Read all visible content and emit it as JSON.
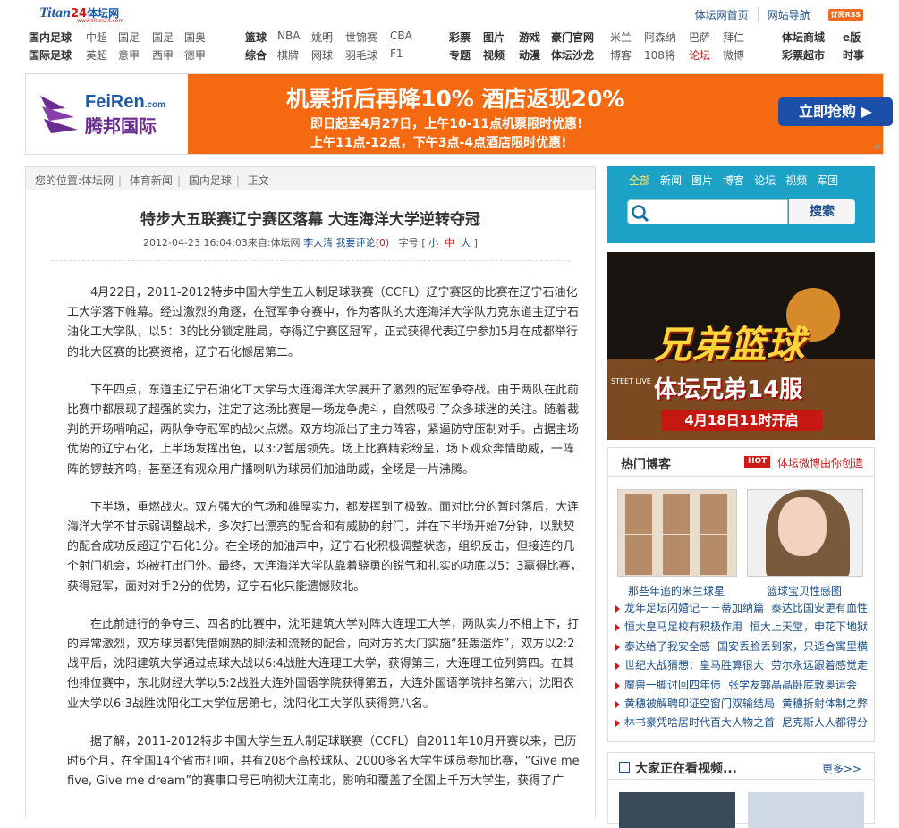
{
  "header": {
    "logo": {
      "titan": "Titan",
      "num": "24",
      "cn": "体坛网",
      "sub": "www.titan24.com"
    },
    "links": [
      "体坛网首页",
      "网站导航"
    ],
    "rss": "订阅RSS"
  },
  "nav": {
    "row1": [
      "国内足球",
      "中超",
      "国足",
      "国足",
      "国奥",
      "篮球",
      "NBA",
      "姚明",
      "世锦赛",
      "CBA",
      "彩票",
      "图片",
      "游戏",
      "豪门官网",
      "米兰",
      "阿森纳",
      "巴萨",
      "拜仁",
      "体坛商城",
      "e版"
    ],
    "row2": [
      "国际足球",
      "英超",
      "意甲",
      "西甲",
      "德甲",
      "综合",
      "棋牌",
      "网球",
      "羽毛球",
      "F1",
      "专题",
      "视频",
      "动漫",
      "体坛沙龙",
      "博客",
      "108将",
      "论坛",
      "微博",
      "彩票超市",
      "时事"
    ]
  },
  "banner": {
    "brand_en": "FeiRen",
    "brand_dom": ".com",
    "brand_cn": "腾邦国际",
    "headline": "机票折后再降10% 酒店返现20%",
    "line1": "即日起至4月27日，上午10-11点机票限时优惠!",
    "line2": "上午11点-12点，下午3点-4点酒店限时优惠!",
    "cta": "立即抢购"
  },
  "breadcrumb": [
    "您的位置:体坛网",
    "体育新闻",
    "国内足球",
    "正文"
  ],
  "article": {
    "title": "特步大五联赛辽宁赛区落幕 大连海洋大学逆转夺冠",
    "date": "2012-04-23 16:04:03",
    "source_label": "来自:",
    "source": "体坛网",
    "author": "李大清",
    "comment": "我要评论",
    "comment_count": "(0)",
    "font_label": "字号:",
    "font_small": "小",
    "font_mid": "中",
    "font_large": "大",
    "paragraphs": [
      "4月22日，2011-2012特步中国大学生五人制足球联赛（CCFL）辽宁赛区的比赛在辽宁石油化工大学落下帷幕。经过激烈的角逐，在冠军争夺赛中，作为客队的大连海洋大学队力克东道主辽宁石油化工大学队，以5：3的比分锁定胜局，夺得辽宁赛区冠军，正式获得代表辽宁参加5月在成都举行的北大区赛的比赛资格，辽宁石化憾居第二。",
      "下午四点，东道主辽宁石油化工大学与大连海洋大学展开了激烈的冠军争夺战。由于两队在此前比赛中都展现了超强的实力，注定了这场比赛是一场龙争虎斗，自然吸引了众多球迷的关注。随着裁判的开场哨响起，两队争夺冠军的战火点燃。双方均派出了主力阵容，紧逼防守压制对手。占据主场优势的辽宁石化，上半场发挥出色，以3:2暂居领先。场上比赛精彩纷呈，场下观众奔情助威，一阵阵的锣鼓齐鸣，甚至还有观众用广播喇叭为球员们加油助威，全场是一片沸腾。",
      "下半场，重燃战火。双方强大的气场和雄厚实力，都发挥到了极致。面对比分的暂时落后，大连海洋大学不甘示弱调整战术，多次打出漂亮的配合和有威胁的射门，并在下半场开始7分钟，以默契的配合成功反超辽宁石化1分。在全场的加油声中，辽宁石化积极调整状态，组织反击，但接连的几个射门机会，均被打出门外。最终，大连海洋大学队靠着骁勇的锐气和扎实的功底以5：3赢得比赛，获得冠军，面对对手2分的优势，辽宁石化只能遗憾败北。",
      "在此前进行的争夺三、四名的比赛中，沈阳建筑大学对阵大连理工大学，两队实力不相上下，打的异常激烈，双方球员都凭借娴熟的脚法和流畅的配合，向对方的大门实施“狂轰滥炸”，双方以2:2战平后，沈阳建筑大学通过点球大战以6:4战胜大连理工大学，获得第三，大连理工位列第四。在其他排位赛中，东北财经大学以5:2战胜大连外国语学院获得第五，大连外国语学院排名第六；沈阳农业大学以6:3战胜沈阳化工大学位居第七，沈阳化工大学队获得第八名。",
      "据了解，2011-2012特步中国大学生五人制足球联赛（CCFL）自2011年10月开赛以来，已历时6个月，在全国14个省市打响，共有208个高校球队、2000多名大学生球员参加比赛，“Give me five, Give me dream”的赛事口号已响彻大江南北，影响和覆盖了全国上千万大学生，获得了广"
    ]
  },
  "search": {
    "tabs": [
      "全部",
      "新闻",
      "图片",
      "博客",
      "论坛",
      "视频",
      "军团"
    ],
    "button": "搜索"
  },
  "ad": {
    "tag": "STEET LIVE",
    "title": "兄弟篮球",
    "subtitle": "体坛兄弟14服",
    "date": "4月18日11时开启"
  },
  "blogs": {
    "title": "热门博客",
    "hot": "HOT",
    "hot_link": "体坛微博由你创造",
    "captions": [
      "那些年追的米兰球星",
      "篮球宝贝性感图"
    ],
    "items": [
      [
        "龙年足坛闪婚记－－蒂加纳篇",
        "泰达比国安更有血性"
      ],
      [
        "恒大皇马足校有积极作用",
        "恒大上天堂，申花下地狱"
      ],
      [
        "泰达给了我安全感",
        "国安丢脸丢到家，只适合寓里横"
      ],
      [
        "世纪大战猜想：皇马胜算很大",
        "劳尔永远跟着感觉走"
      ],
      [
        "魔兽一脚讨回四年债",
        "张学友郭晶晶卧底敦奥运会"
      ],
      [
        "黄穗被解聘印证空窗门双输结局",
        "黄穗折射体制之弊"
      ],
      [
        "林书豪凭啥居时代百大人物之首",
        "尼克斯人人都得分"
      ]
    ]
  },
  "videos": {
    "title": "大家正在看视频...",
    "more": "更多>>"
  }
}
